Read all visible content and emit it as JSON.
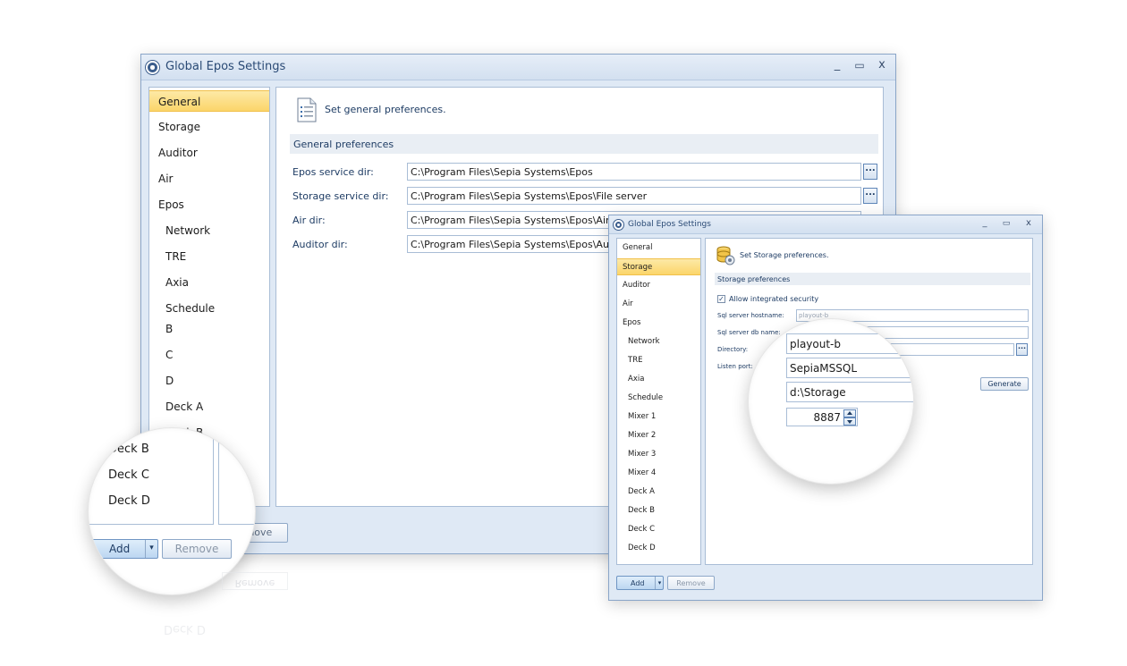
{
  "main_window": {
    "title": "Global Epos Settings",
    "controls": {
      "minimize": "_",
      "maximize": "▭",
      "close": "x"
    },
    "nav_items": [
      "General",
      "Storage",
      "Auditor",
      "Air",
      "Epos",
      "Network",
      "TRE",
      "Axia",
      "Schedule",
      "B",
      "C",
      "D",
      "Deck A",
      "Deck B"
    ],
    "selected": "General",
    "header_text": "Set general preferences.",
    "section_title": "General preferences",
    "fields": [
      {
        "label": "Epos service dir:",
        "value": "C:\\Program Files\\Sepia Systems\\Epos"
      },
      {
        "label": "Storage service dir:",
        "value": "C:\\Program Files\\Sepia Systems\\Epos\\File server"
      },
      {
        "label": "Air dir:",
        "value": "C:\\Program Files\\Sepia Systems\\Epos\\Air"
      },
      {
        "label": "Auditor dir:",
        "value": "C:\\Program Files\\Sepia Systems\\Epos\\Auditor"
      }
    ],
    "browse_label": "...",
    "remove_label": "Remove"
  },
  "main_magnifier": {
    "items": [
      "Deck B",
      "Deck C",
      "Deck D"
    ],
    "add_label": "Add",
    "dropdown_glyph": "▾",
    "remove_label": "Remove"
  },
  "storage_window": {
    "title": "Global Epos Settings",
    "controls": {
      "minimize": "_",
      "maximize": "▭",
      "close": "x"
    },
    "nav_items": [
      "General",
      "Storage",
      "Auditor",
      "Air",
      "Epos",
      "Network",
      "TRE",
      "Axia",
      "Schedule",
      "Mixer 1",
      "Mixer 2",
      "Mixer 3",
      "Mixer 4",
      "Deck A",
      "Deck B",
      "Deck C",
      "Deck D"
    ],
    "selected": "Storage",
    "header_text": "Set Storage preferences.",
    "section_title": "Storage preferences",
    "checkbox_label": "Allow integrated security",
    "checkbox_checked": true,
    "labels": [
      "Sql server hostname:",
      "Sql server db name:",
      "Directory:",
      "Listen port:"
    ],
    "hostname_value": "playout-b",
    "generate_label": "Generate",
    "browse_label": "...",
    "add_label": "Add",
    "dropdown_glyph": "▾",
    "remove_label": "Remove"
  },
  "storage_magnifier": {
    "hostname": "playout-b",
    "db_name": "SepiaMSSQL",
    "directory": "d:\\Storage",
    "port": "8887"
  },
  "reflection": {
    "remove_label": "Remove",
    "item": "Deck D"
  }
}
